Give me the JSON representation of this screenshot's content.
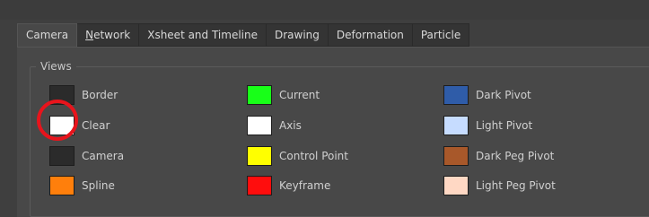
{
  "tabs": [
    {
      "label": "Camera",
      "active": true
    },
    {
      "label": "Network",
      "active": false,
      "underline_char": "N"
    },
    {
      "label": "Xsheet and Timeline",
      "active": false
    },
    {
      "label": "Drawing",
      "active": false
    },
    {
      "label": "Deformation",
      "active": false
    },
    {
      "label": "Particle",
      "active": false
    }
  ],
  "views_group": {
    "title": "Views",
    "columns": [
      [
        {
          "label": "Border",
          "color": "#2b2b2b"
        },
        {
          "label": "Clear",
          "color": "#ffffff"
        },
        {
          "label": "Camera",
          "color": "#2b2b2b"
        },
        {
          "label": "Spline",
          "color": "#ff7f0c"
        }
      ],
      [
        {
          "label": "Current",
          "color": "#18ff18"
        },
        {
          "label": "Axis",
          "color": "#ffffff"
        },
        {
          "label": "Control Point",
          "color": "#ffff00"
        },
        {
          "label": "Keyframe",
          "color": "#ff0d0d"
        }
      ],
      [
        {
          "label": "Dark Pivot",
          "color": "#2f5ca8"
        },
        {
          "label": "Light Pivot",
          "color": "#c6dcff"
        },
        {
          "label": "Dark Peg Pivot",
          "color": "#a8582a"
        },
        {
          "label": "Light Peg Pivot",
          "color": "#ffd8c4"
        }
      ]
    ]
  },
  "annotation": {
    "target": "Clear",
    "color": "#e8141c"
  }
}
